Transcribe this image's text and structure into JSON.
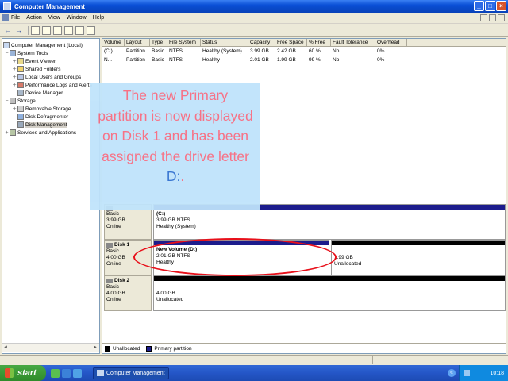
{
  "window": {
    "title": "Computer Management",
    "controls": {
      "minimize": "_",
      "maximize": "□",
      "close": "×"
    }
  },
  "menubar": {
    "items": [
      "File",
      "Action",
      "View",
      "Window",
      "Help"
    ]
  },
  "tree": {
    "items": [
      {
        "label": "Computer Management (Local)",
        "level": 0,
        "expander": ""
      },
      {
        "label": "System Tools",
        "level": 1,
        "expander": "−"
      },
      {
        "label": "Event Viewer",
        "level": 2,
        "expander": "+"
      },
      {
        "label": "Shared Folders",
        "level": 2,
        "expander": "+"
      },
      {
        "label": "Local Users and Groups",
        "level": 2,
        "expander": "+"
      },
      {
        "label": "Performance Logs and Alerts",
        "level": 2,
        "expander": "+"
      },
      {
        "label": "Device Manager",
        "level": 2,
        "expander": ""
      },
      {
        "label": "Storage",
        "level": 1,
        "expander": "−"
      },
      {
        "label": "Removable Storage",
        "level": 2,
        "expander": "+"
      },
      {
        "label": "Disk Defragmenter",
        "level": 2,
        "expander": ""
      },
      {
        "label": "Disk Management",
        "level": 2,
        "expander": "",
        "selected": true
      },
      {
        "label": "Services and Applications",
        "level": 1,
        "expander": "+"
      }
    ],
    "scroll_left": "◄",
    "scroll_right": "►"
  },
  "volume_list": {
    "columns": [
      "Volume",
      "Layout",
      "Type",
      "File System",
      "Status",
      "Capacity",
      "Free Space",
      "% Free",
      "Fault Tolerance",
      "Overhead"
    ],
    "rows": [
      [
        "(C:)",
        "Partition",
        "Basic",
        "NTFS",
        "Healthy (System)",
        "3.99 GB",
        "2.42 GB",
        "60 %",
        "No",
        "0%"
      ],
      [
        "N...",
        "Partition",
        "Basic",
        "NTFS",
        "Healthy",
        "2.01 GB",
        "1.99 GB",
        "99 %",
        "No",
        "0%"
      ]
    ]
  },
  "disks": [
    {
      "name": "",
      "type": "Basic",
      "size": "3.99 GB",
      "status": "Online",
      "partitions": [
        {
          "name": "(C:)",
          "size": "3.99 GB NTFS",
          "status": "Healthy (System)",
          "bar_color": "#1c1c8c"
        }
      ]
    },
    {
      "name": "Disk 1",
      "type": "Basic",
      "size": "4.00 GB",
      "status": "Online",
      "partitions": [
        {
          "name": "New Volume  (D:)",
          "size": "2.01 GB NTFS",
          "status": "Healthy",
          "bar_color": "#1c1c8c"
        },
        {
          "name": "",
          "size": "1.99 GB",
          "status": "Unallocated",
          "bar_color": "#000000"
        }
      ]
    },
    {
      "name": "Disk 2",
      "type": "Basic",
      "size": "4.00 GB",
      "status": "Online",
      "partitions": [
        {
          "name": "",
          "size": "4.00 GB",
          "status": "Unallocated",
          "bar_color": "#000000"
        }
      ]
    }
  ],
  "legend": {
    "items": [
      {
        "label": "Unallocated",
        "color": "#000000"
      },
      {
        "label": "Primary partition",
        "color": "#1c1c8c"
      }
    ]
  },
  "callout": {
    "text_before": "The new Primary partition is now displayed on Disk 1 and has been assigned the drive letter ",
    "drive": "D:",
    "text_after": "."
  },
  "taskbar": {
    "start_label": "start",
    "task_item": "Computer Management",
    "language": "EN",
    "clock": "10:18",
    "expand_glyph": "«"
  },
  "colors": {
    "primary_partition": "#1c1c8c",
    "unallocated": "#000000",
    "callout_bg": "#bfe3fb",
    "callout_text": "#f76a7f",
    "highlight_oval": "#e8101a"
  }
}
